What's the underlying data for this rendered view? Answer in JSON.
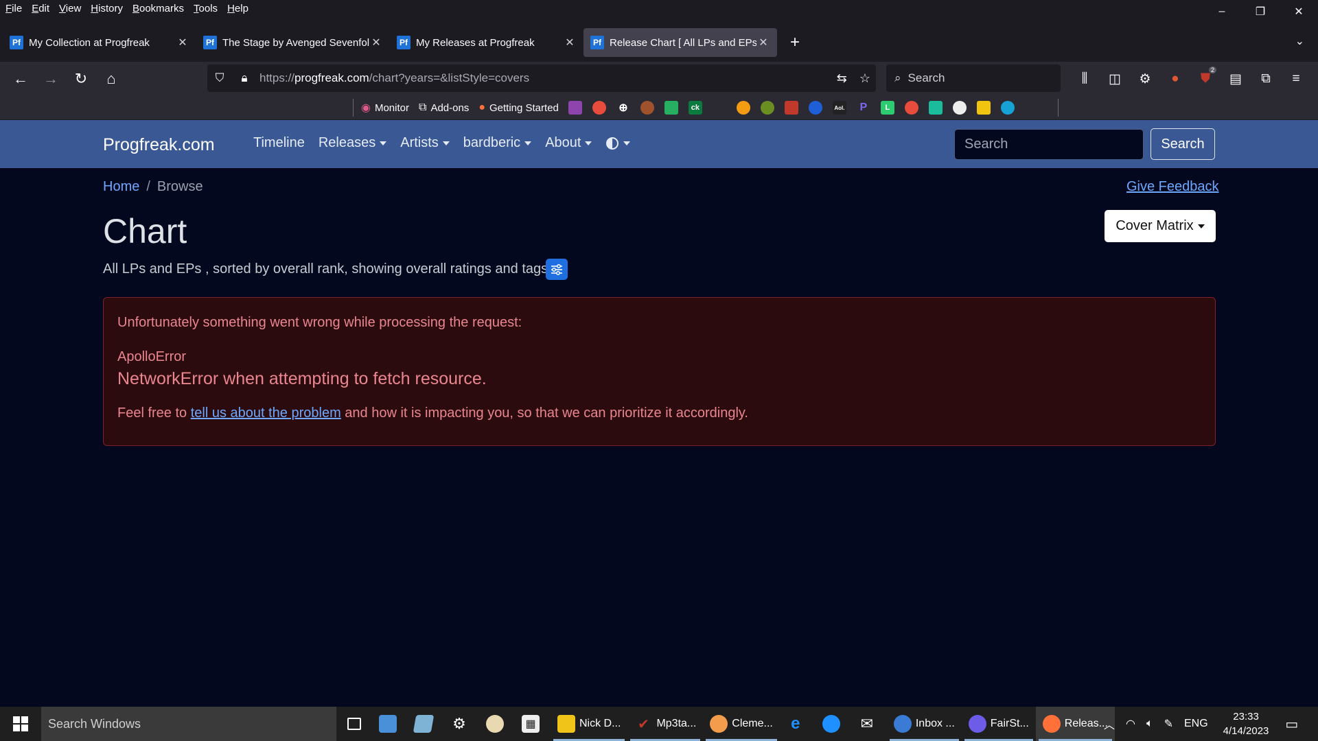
{
  "menu": [
    "File",
    "Edit",
    "View",
    "History",
    "Bookmarks",
    "Tools",
    "Help"
  ],
  "window_controls": {
    "minimize": "–",
    "restore": "❐",
    "close": "✕"
  },
  "tabs": [
    {
      "favicon": "Pf",
      "title": "My Collection at Progfreak"
    },
    {
      "favicon": "Pf",
      "title": "The Stage by Avenged Sevenfold"
    },
    {
      "favicon": "Pf",
      "title": "My Releases at Progfreak"
    },
    {
      "favicon": "Pf",
      "title": "Release Chart [ All LPs and EPs ]"
    }
  ],
  "url": {
    "prefix": "https://",
    "domain": "progfreak.com",
    "path": "/chart?years=&listStyle=covers"
  },
  "search_placeholder": "Search",
  "toolbar_badge": "2",
  "bookmarks": [
    {
      "icon": "monitor-icon",
      "label": "Monitor"
    },
    {
      "icon": "puzzle-icon",
      "label": "Add-ons"
    },
    {
      "icon": "firefox-icon",
      "label": "Getting Started"
    }
  ],
  "bookmark_icon_text": [
    "",
    "",
    "",
    "",
    "",
    "ck",
    "",
    "",
    "",
    "",
    "",
    "Aol.",
    "P",
    "L",
    "",
    "",
    "",
    "",
    ""
  ],
  "site": {
    "brand": "Progfreak.com",
    "nav": [
      {
        "label": "Timeline",
        "dropdown": false
      },
      {
        "label": "Releases",
        "dropdown": true
      },
      {
        "label": "Artists",
        "dropdown": true
      },
      {
        "label": "bardberic",
        "dropdown": true
      },
      {
        "label": "About",
        "dropdown": true
      }
    ],
    "search_placeholder": "Search",
    "search_button": "Search"
  },
  "breadcrumb": {
    "home": "Home",
    "separator": "/",
    "current": "Browse"
  },
  "feedback_link": "Give Feedback",
  "title": "Chart",
  "view_dropdown": "Cover Matrix",
  "subtitle": "All LPs and EPs , sorted by overall rank, showing overall ratings and tags",
  "error": {
    "message": "Unfortunately something went wrong while processing the request:",
    "type": "ApolloError",
    "detail": "NetworkError when attempting to fetch resource.",
    "footer_before": "Feel free to ",
    "footer_link": "tell us about the problem",
    "footer_after": " and how it is impacting you, so that we can prioritize it accordingly."
  },
  "taskbar": {
    "search_placeholder": "Search Windows",
    "apps": [
      {
        "label": "",
        "icon": "task-view-icon"
      },
      {
        "label": "",
        "icon": "control-panel-icon"
      },
      {
        "label": "",
        "icon": "notepad-icon"
      },
      {
        "label": "",
        "icon": "settings-icon"
      },
      {
        "label": "",
        "icon": "paint-icon"
      },
      {
        "label": "",
        "icon": "calculator-icon"
      },
      {
        "label": "Nick D...",
        "icon": "folder-icon"
      },
      {
        "label": "Mp3ta...",
        "icon": "mp3tag-icon"
      },
      {
        "label": "Cleme...",
        "icon": "clementine-icon"
      },
      {
        "label": "",
        "icon": "edge-icon"
      },
      {
        "label": "",
        "icon": "safari-icon"
      },
      {
        "label": "",
        "icon": "mail-icon"
      },
      {
        "label": "Inbox ...",
        "icon": "thunderbird-icon"
      },
      {
        "label": "FairSt...",
        "icon": "fairstars-icon"
      },
      {
        "label": "Releas...",
        "icon": "firefox-icon"
      }
    ],
    "language": "ENG",
    "time": "23:33",
    "date": "4/14/2023"
  },
  "colors": {
    "site_nav_bg": "#3a5894",
    "page_bg": "#03081f",
    "alert_bg": "#2c0b0e",
    "alert_text": "#ea868f",
    "link": "#6ea8fe",
    "favicon": "#1e72d8"
  }
}
